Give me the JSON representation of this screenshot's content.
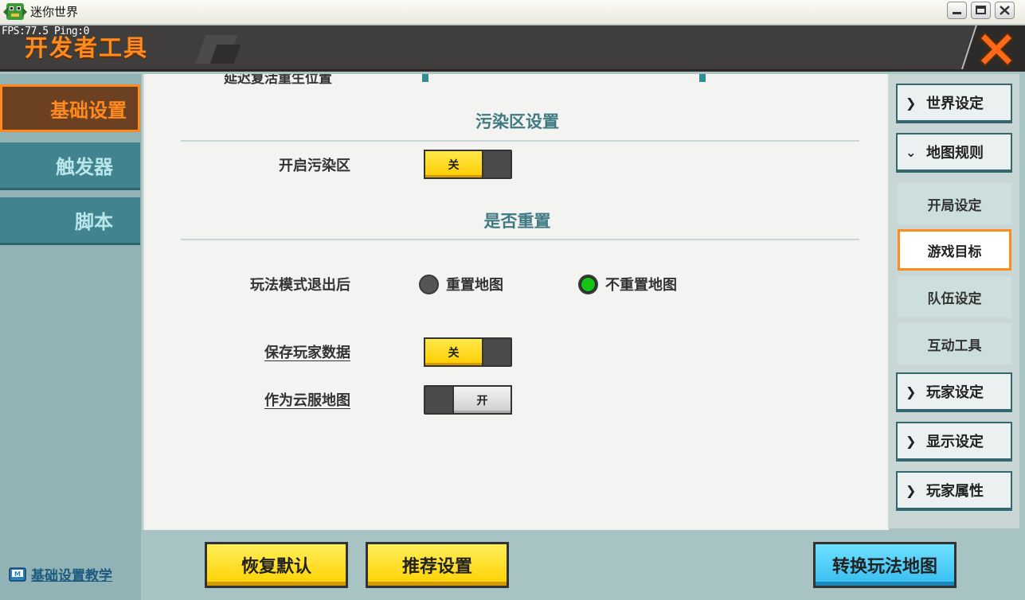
{
  "window": {
    "title": "迷你世界",
    "app_icon": "mini-world-app-icon"
  },
  "header": {
    "fps": "FPS:77.5  Ping:0",
    "title": "开发者工具",
    "close_icon": "close-x-icon"
  },
  "sidebar": {
    "tabs": [
      {
        "label": "基础设置",
        "active": true
      },
      {
        "label": "触发器",
        "active": false
      },
      {
        "label": "脚本",
        "active": false
      }
    ],
    "tutorial_link": "基础设置教学"
  },
  "main": {
    "clipped_top_label": "延迟复活重生位置",
    "pollution": {
      "section_title": "污染区设置",
      "enable_label": "开启污染区",
      "enable_state": "关"
    },
    "reset": {
      "section_title": "是否重置",
      "exit_label": "玩法模式退出后",
      "options": [
        {
          "label": "重置地图",
          "selected": false
        },
        {
          "label": "不重置地图",
          "selected": true
        }
      ],
      "save_player_data_label": "保存玩家数据",
      "save_player_data_state": "关",
      "cloud_map_label": "作为云服地图",
      "cloud_map_state": "开"
    }
  },
  "right_panel": {
    "categories": [
      {
        "label": "世界设定",
        "expanded": false
      },
      {
        "label": "地图规则",
        "expanded": true
      },
      {
        "label": "玩家设定",
        "expanded": false
      },
      {
        "label": "显示设定",
        "expanded": false
      },
      {
        "label": "玩家属性",
        "expanded": false
      }
    ],
    "map_rules_items": [
      {
        "label": "开局设定",
        "selected": false
      },
      {
        "label": "游戏目标",
        "selected": true
      },
      {
        "label": "队伍设定",
        "selected": false
      },
      {
        "label": "互动工具",
        "selected": false
      }
    ]
  },
  "footer": {
    "restore_default": "恢复默认",
    "recommended_settings": "推荐设置",
    "convert_map": "转换玩法地图"
  },
  "colors": {
    "accent_orange": "#ff8a1e",
    "toggle_yellow": "#ffcc00",
    "sidebar_teal": "#41848f",
    "convert_blue": "#35bdf0",
    "radio_selected_green": "#16c416"
  }
}
